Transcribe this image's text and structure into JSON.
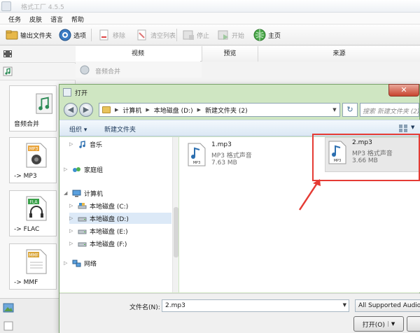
{
  "app": {
    "title": "格式工厂 4.5.5",
    "menu": [
      "任务",
      "皮肤",
      "语言",
      "帮助"
    ],
    "toolbar": {
      "output_folder": "输出文件夹",
      "options": "选项",
      "remove": "移除",
      "clear_list": "清空列表",
      "stop": "停止",
      "start": "开始",
      "home": "主页"
    },
    "category_video": "视频",
    "sub_audio_merge": "音频合并",
    "columns": {
      "preview": "预览",
      "source": "来源"
    },
    "tiles": [
      "音频合并",
      "-> MP3",
      "-> FLAC",
      "-> MMF"
    ],
    "tile_badges": {
      "mp3": "MP3",
      "flac": "FLA",
      "mmf": "MMF"
    }
  },
  "dialog": {
    "title": "打开",
    "breadcrumbs": [
      "计算机",
      "本地磁盘 (D:)",
      "新建文件夹 (2)"
    ],
    "search_placeholder": "搜索 新建文件夹 (2)",
    "organize": "组织 ▾",
    "new_folder": "新建文件夹",
    "nav": [
      {
        "label": "音乐",
        "icon": "music-note-icon"
      },
      {
        "label": "家庭组",
        "icon": "homegroup-icon"
      },
      {
        "label": "计算机",
        "icon": "computer-icon"
      },
      {
        "label": "本地磁盘 (C:)",
        "icon": "drive-icon"
      },
      {
        "label": "本地磁盘 (D:)",
        "icon": "drive-icon"
      },
      {
        "label": "本地磁盘 (E:)",
        "icon": "drive-icon"
      },
      {
        "label": "本地磁盘 (F:)",
        "icon": "drive-icon"
      },
      {
        "label": "网络",
        "icon": "network-icon"
      }
    ],
    "files": [
      {
        "name": "1.mp3",
        "type": "MP3 格式声音",
        "size": "7.63 MB"
      },
      {
        "name": "2.mp3",
        "type": "MP3 格式声音",
        "size": "3.66 MB"
      }
    ],
    "file_icon_badge": "MP3",
    "filename_label": "文件名(N):",
    "filename_value": "2.mp3",
    "filter_value": "All Supported Audio",
    "open_button": "打开(O)"
  },
  "colors": {
    "dialog_frame": "#cfe6c2",
    "annotation": "#e53b34",
    "close_button": "#c8452f"
  }
}
